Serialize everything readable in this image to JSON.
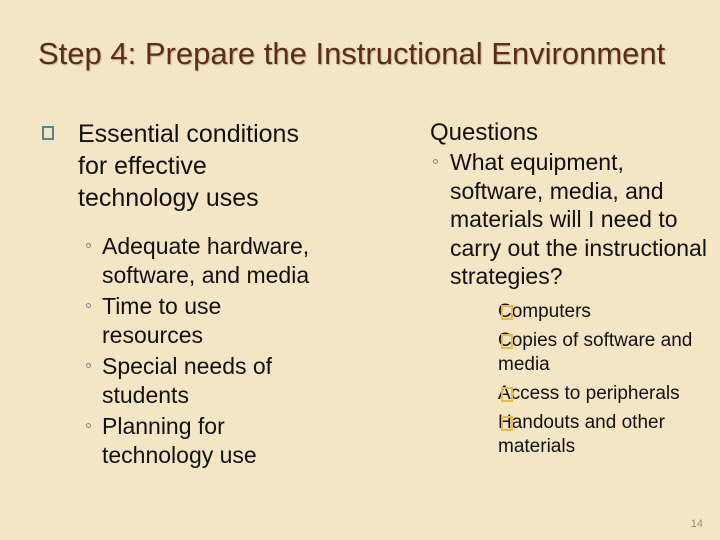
{
  "slide": {
    "title": "Step 4: Prepare the Instructional Environment",
    "page_number": "14",
    "colors": {
      "background": "#f3e3be",
      "title": "#5a2d18",
      "primary_bullet": "#4a8a88",
      "tertiary_bullet": "#e8b84a"
    }
  },
  "left_column": {
    "heading": "Essential conditions for effective technology uses",
    "heading_bullet_icon": "square-outline-icon",
    "items": [
      {
        "text": "Adequate hardware, software, and media"
      },
      {
        "text": "Time to use resources"
      },
      {
        "text": "Special needs of students"
      },
      {
        "text": "Planning for technology use"
      }
    ]
  },
  "right_column": {
    "heading": "Questions",
    "question": "What equipment, software, media, and materials will I need to carry out the instructional strategies?",
    "answers": [
      {
        "text": "Computers"
      },
      {
        "text": "Copies of software and media"
      },
      {
        "text": "Access to peripherals"
      },
      {
        "text": "Handouts and other materials"
      }
    ]
  }
}
